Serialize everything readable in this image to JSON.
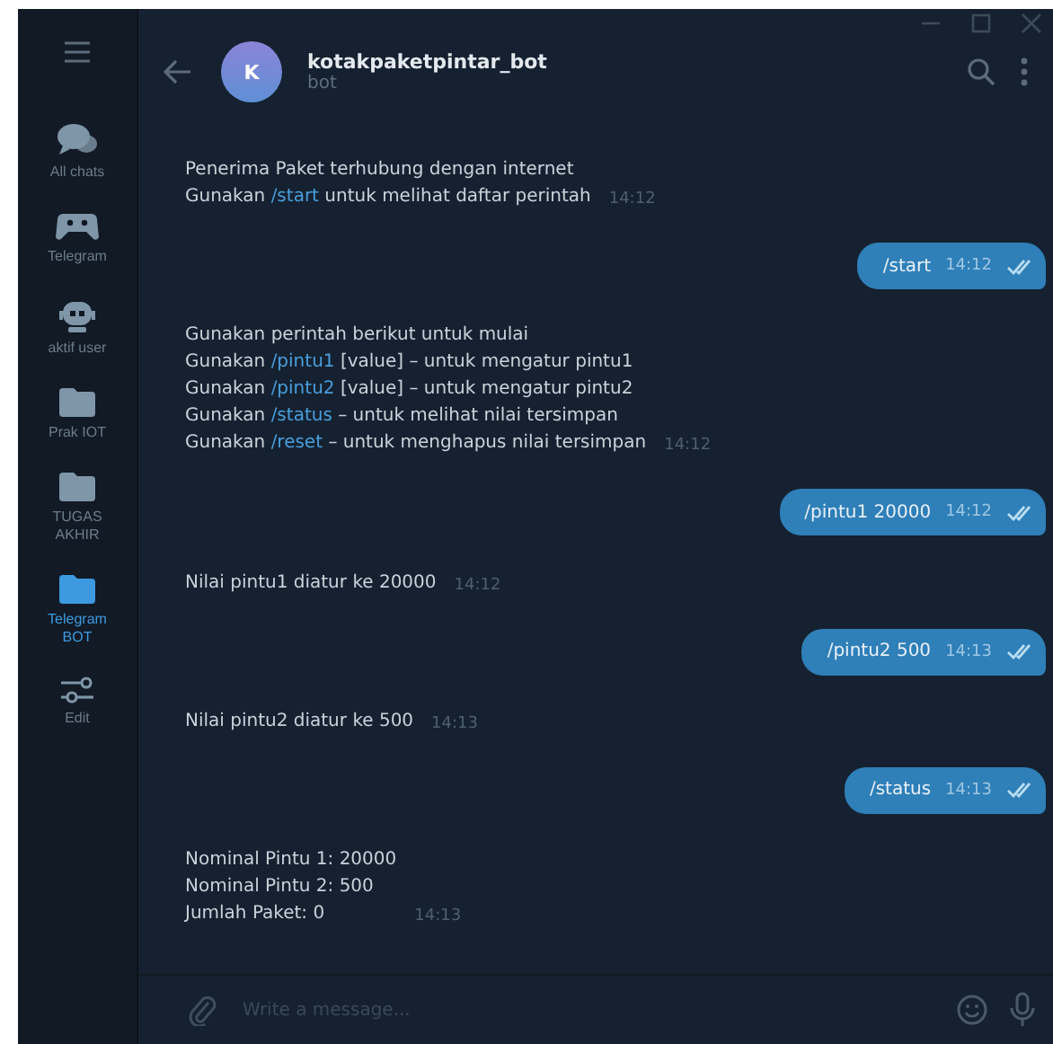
{
  "window": {
    "controls": [
      {
        "kind": "minimize"
      },
      {
        "kind": "maximize"
      },
      {
        "kind": "close"
      }
    ]
  },
  "sidebar": {
    "items": [
      {
        "label": "All chats",
        "kind": "chats",
        "selected": false
      },
      {
        "label": "Telegram",
        "kind": "game",
        "selected": false
      },
      {
        "label": "aktif user",
        "kind": "bot",
        "selected": false
      },
      {
        "label": "Prak IOT",
        "kind": "folder",
        "selected": false
      },
      {
        "label": "TUGAS AKHIR",
        "kind": "folder",
        "selected": false
      },
      {
        "label": "Telegram BOT",
        "kind": "folder",
        "selected": true
      },
      {
        "label": "Edit",
        "kind": "edit",
        "selected": false
      }
    ]
  },
  "chat": {
    "avatar": "K",
    "name": "kotakpaketpintar_bot",
    "status": "bot"
  },
  "messages": [
    {
      "kind": "in",
      "time": "14:12",
      "lines": [
        [
          {
            "text": "Penerima Paket terhubung dengan internet",
            "kind": "plain"
          }
        ],
        [
          {
            "text": "Gunakan ",
            "kind": "plain"
          },
          {
            "text": "/start",
            "kind": "command"
          },
          {
            "text": " untuk melihat daftar perintah",
            "kind": "plain"
          }
        ]
      ]
    },
    {
      "kind": "out",
      "time": "14:12",
      "text": "/start",
      "read": true
    },
    {
      "kind": "in",
      "time": "14:12",
      "lines": [
        [
          {
            "text": "Gunakan perintah berikut untuk mulai",
            "kind": "plain"
          }
        ],
        [
          {
            "text": "Gunakan ",
            "kind": "plain"
          },
          {
            "text": "/pintu1",
            "kind": "command"
          },
          {
            "text": " [value] – untuk mengatur pintu1",
            "kind": "plain"
          }
        ],
        [
          {
            "text": "Gunakan ",
            "kind": "plain"
          },
          {
            "text": "/pintu2",
            "kind": "command"
          },
          {
            "text": " [value] – untuk mengatur pintu2",
            "kind": "plain"
          }
        ],
        [
          {
            "text": "Gunakan ",
            "kind": "plain"
          },
          {
            "text": "/status",
            "kind": "command"
          },
          {
            "text": " – untuk melihat nilai tersimpan",
            "kind": "plain"
          }
        ],
        [
          {
            "text": "Gunakan ",
            "kind": "plain"
          },
          {
            "text": "/reset",
            "kind": "command"
          },
          {
            "text": " – untuk menghapus nilai tersimpan",
            "kind": "plain"
          }
        ]
      ]
    },
    {
      "kind": "out",
      "time": "14:12",
      "text": "/pintu1 20000",
      "read": true
    },
    {
      "kind": "in",
      "time": "14:12",
      "lines": [
        [
          {
            "text": "Nilai pintu1 diatur ke 20000",
            "kind": "plain"
          }
        ]
      ]
    },
    {
      "kind": "out",
      "time": "14:13",
      "text": "/pintu2 500",
      "read": true
    },
    {
      "kind": "in",
      "time": "14:13",
      "lines": [
        [
          {
            "text": "Nilai pintu2 diatur ke 500",
            "kind": "plain"
          }
        ]
      ]
    },
    {
      "kind": "out",
      "time": "14:13",
      "text": "/status",
      "read": true
    },
    {
      "kind": "in",
      "time": "14:13",
      "lines": [
        [
          {
            "text": "Nominal Pintu 1: 20000",
            "kind": "plain"
          }
        ],
        [
          {
            "text": "Nominal Pintu 2: 500",
            "kind": "plain"
          }
        ],
        [
          {
            "text": "Jumlah Paket: 0",
            "kind": "plain"
          }
        ]
      ]
    }
  ],
  "composer": {
    "placeholder": "Write a message..."
  }
}
